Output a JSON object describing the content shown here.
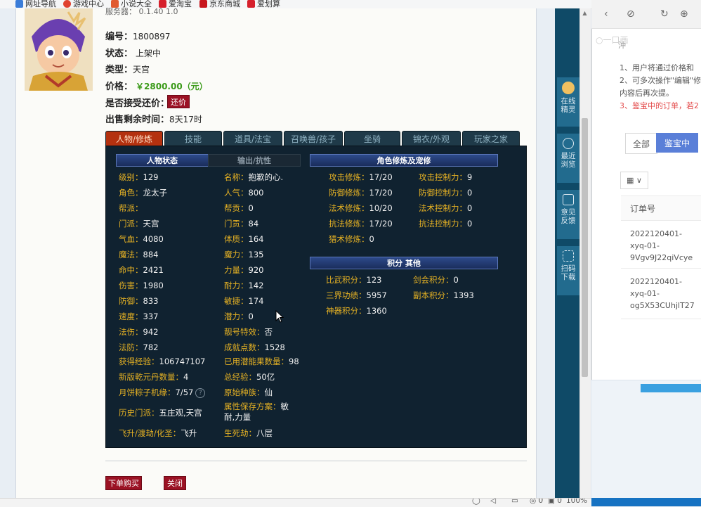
{
  "bookmarks": [
    {
      "label": "网址导航",
      "color": "#3b7dd8"
    },
    {
      "label": "游戏中心",
      "color": "#e0422f"
    },
    {
      "label": "小说大全",
      "color": "#e05a2f"
    },
    {
      "label": "爱淘宝",
      "color": "#d6202c"
    },
    {
      "label": "京东商城",
      "color": "#c8161d"
    },
    {
      "label": "爱划算",
      "color": "#d6202c"
    }
  ],
  "top_info": "服务器：                                          0.1.40 1.0    ",
  "item": {
    "id_label": "编号：",
    "id_value": "1800897",
    "status_label": "状态：",
    "status_value": "上架中",
    "type_label": "类型：",
    "type_value": "天宫",
    "price_label": "价格：",
    "price_value": "￥2800.00（元）",
    "bargain_label": "是否接受还价：",
    "bargain_button": "还价",
    "remain_label": "出售剩余时间：",
    "remain_value": "8天17时"
  },
  "tabs": [
    "人物/修炼",
    "技能",
    "道具/法宝",
    "召唤兽/孩子",
    "坐骑",
    "锦衣/外观",
    "玩家之家"
  ],
  "panel": {
    "hdr_status": "人物状态",
    "hdr_output": "输出/抗性",
    "hdr_cultivation": "角色修炼及宠修",
    "hdr_points": "积分  其他",
    "left_col": [
      {
        "k": "级别：",
        "v": "129"
      },
      {
        "k": "角色：",
        "v": "龙太子"
      },
      {
        "k": "帮派：",
        "v": ""
      },
      {
        "k": "门派：",
        "v": "天宫"
      },
      {
        "k": "气血：",
        "v": "4080"
      },
      {
        "k": "魔法：",
        "v": "884"
      },
      {
        "k": "命中：",
        "v": "2421"
      },
      {
        "k": "伤害：",
        "v": "1980"
      },
      {
        "k": "防御：",
        "v": "833"
      },
      {
        "k": "速度：",
        "v": "337"
      },
      {
        "k": "法伤：",
        "v": "942"
      },
      {
        "k": "法防：",
        "v": "782"
      },
      {
        "k": "获得经验：",
        "v": "106747107"
      },
      {
        "k": "新版乾元丹数量：",
        "v": "4"
      },
      {
        "k": "月饼粽子机缘：",
        "v": "7/57"
      },
      {
        "k": "历史门派：",
        "v": "五庄观,天宫"
      },
      {
        "k": "飞升/渡劫/化圣：",
        "v": "飞升"
      }
    ],
    "mid_col": [
      {
        "k": "名称：",
        "v": "抱歉的心."
      },
      {
        "k": "人气：",
        "v": "800"
      },
      {
        "k": "帮贡：",
        "v": "0"
      },
      {
        "k": "门贡：",
        "v": "84"
      },
      {
        "k": "体质：",
        "v": "164"
      },
      {
        "k": "魔力：",
        "v": "135"
      },
      {
        "k": "力量：",
        "v": "920"
      },
      {
        "k": "耐力：",
        "v": "142"
      },
      {
        "k": "敏捷：",
        "v": "174"
      },
      {
        "k": "潜力：",
        "v": "0"
      },
      {
        "k": "靓号特效：",
        "v": "否"
      },
      {
        "k": "成就点数：",
        "v": "1528"
      },
      {
        "k": "已用潜能果数量：",
        "v": "98"
      },
      {
        "k": "总经验：",
        "v": "50亿"
      },
      {
        "k": "原始种族：",
        "v": "仙"
      },
      {
        "k": "属性保存方案：",
        "v": "敏",
        "v2": "耐,力量"
      },
      {
        "k": "生死劫：",
        "v": "八层"
      }
    ],
    "cult_left": [
      {
        "k": "攻击修炼：",
        "v": "17/20"
      },
      {
        "k": "防御修炼：",
        "v": "17/20"
      },
      {
        "k": "法术修炼：",
        "v": "10/20"
      },
      {
        "k": "抗法修炼：",
        "v": "17/20"
      },
      {
        "k": "猎术修炼：",
        "v": "0"
      }
    ],
    "cult_right": [
      {
        "k": "攻击控制力：",
        "v": "9"
      },
      {
        "k": "防御控制力：",
        "v": "0"
      },
      {
        "k": "法术控制力：",
        "v": "0"
      },
      {
        "k": "抗法控制力：",
        "v": "0"
      }
    ],
    "points": [
      {
        "k": "比武积分：",
        "v": "123"
      },
      {
        "k": "剑会积分：",
        "v": "0"
      },
      {
        "k": "三界功绩：",
        "v": "5957"
      },
      {
        "k": "副本积分：",
        "v": "1393"
      },
      {
        "k": "神器积分：",
        "v": "1360"
      }
    ]
  },
  "actions": {
    "buy": "下单购买",
    "close": "关闭"
  },
  "sidebar": [
    {
      "label1": "在线",
      "label2": "精灵"
    },
    {
      "label1": "最近",
      "label2": "浏览"
    },
    {
      "label1": "意见",
      "label2": "反馈"
    },
    {
      "label1": "扫码",
      "label2": "下载"
    }
  ],
  "statusbar": {
    "zoom": "100%",
    "count1": "0",
    "count2": "0"
  },
  "right": {
    "logo_text": "○一口画",
    "line_zero": "沖",
    "line1": "1、用户将通过价格和",
    "line2": "2、可多次操作\"编辑\"修",
    "line2b": "内容后再次提。",
    "line3": "3、鉴宝中的订单，若2",
    "filter_all": "全部",
    "filter_jb": "鉴宝中",
    "grid_icon": "▦ ∨",
    "col_order": "订单号",
    "orders": [
      {
        "l1": "2022120401-",
        "l2": "xyq-01-",
        "l3": "9Vgv9J22qiVcye"
      },
      {
        "l1": "2022120401-",
        "l2": "xyq-01-",
        "l3": "og5X53CUhjlT27"
      }
    ]
  }
}
